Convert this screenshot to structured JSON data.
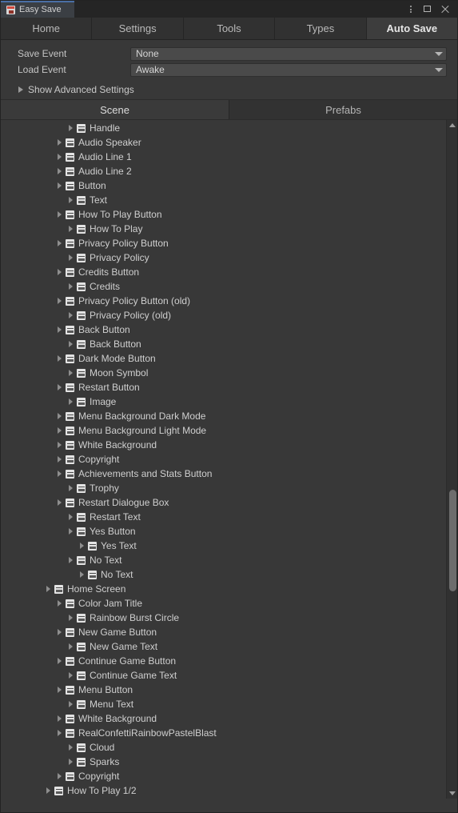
{
  "window": {
    "tab_title": "Easy Save",
    "app_icon": "easy-save-icon",
    "controls": {
      "menu": "kebab-menu-icon",
      "maximize": "maximize-icon",
      "close": "close-icon"
    }
  },
  "tabs": [
    {
      "label": "Home",
      "active": false
    },
    {
      "label": "Settings",
      "active": false
    },
    {
      "label": "Tools",
      "active": false
    },
    {
      "label": "Types",
      "active": false
    },
    {
      "label": "Auto Save",
      "active": true
    }
  ],
  "settings": {
    "fields": [
      {
        "label": "Save Event",
        "value": "None"
      },
      {
        "label": "Load Event",
        "value": "Awake"
      }
    ],
    "advanced_foldout": "Show Advanced Settings"
  },
  "source_tabs": [
    {
      "label": "Scene",
      "active": true
    },
    {
      "label": "Prefabs",
      "active": false
    }
  ],
  "tree": [
    {
      "depth": 2,
      "label": "Handle"
    },
    {
      "depth": 1,
      "label": "Audio Speaker"
    },
    {
      "depth": 1,
      "label": "Audio Line 1"
    },
    {
      "depth": 1,
      "label": "Audio Line 2"
    },
    {
      "depth": 1,
      "label": "Button"
    },
    {
      "depth": 2,
      "label": "Text"
    },
    {
      "depth": 1,
      "label": "How To Play Button"
    },
    {
      "depth": 2,
      "label": "How To Play"
    },
    {
      "depth": 1,
      "label": "Privacy Policy Button"
    },
    {
      "depth": 2,
      "label": "Privacy Policy"
    },
    {
      "depth": 1,
      "label": "Credits Button"
    },
    {
      "depth": 2,
      "label": "Credits"
    },
    {
      "depth": 1,
      "label": "Privacy Policy Button (old)"
    },
    {
      "depth": 2,
      "label": "Privacy Policy (old)"
    },
    {
      "depth": 1,
      "label": "Back Button"
    },
    {
      "depth": 2,
      "label": "Back Button"
    },
    {
      "depth": 1,
      "label": "Dark Mode Button"
    },
    {
      "depth": 2,
      "label": "Moon Symbol"
    },
    {
      "depth": 1,
      "label": "Restart Button"
    },
    {
      "depth": 2,
      "label": "Image"
    },
    {
      "depth": 1,
      "label": "Menu Background Dark Mode"
    },
    {
      "depth": 1,
      "label": "Menu Background Light Mode"
    },
    {
      "depth": 1,
      "label": "White Background"
    },
    {
      "depth": 1,
      "label": "Copyright"
    },
    {
      "depth": 1,
      "label": "Achievements and Stats Button"
    },
    {
      "depth": 2,
      "label": "Trophy"
    },
    {
      "depth": 1,
      "label": "Restart Dialogue Box"
    },
    {
      "depth": 2,
      "label": "Restart Text"
    },
    {
      "depth": 2,
      "label": "Yes Button"
    },
    {
      "depth": 3,
      "label": "Yes Text"
    },
    {
      "depth": 2,
      "label": "No Text"
    },
    {
      "depth": 3,
      "label": "No Text"
    },
    {
      "depth": 0,
      "label": "Home Screen"
    },
    {
      "depth": 1,
      "label": "Color Jam Title"
    },
    {
      "depth": 2,
      "label": "Rainbow Burst Circle"
    },
    {
      "depth": 1,
      "label": "New Game Button"
    },
    {
      "depth": 2,
      "label": "New Game Text"
    },
    {
      "depth": 1,
      "label": "Continue Game Button"
    },
    {
      "depth": 2,
      "label": "Continue Game Text"
    },
    {
      "depth": 1,
      "label": "Menu Button"
    },
    {
      "depth": 2,
      "label": "Menu Text"
    },
    {
      "depth": 1,
      "label": "White Background"
    },
    {
      "depth": 1,
      "label": "RealConfettiRainbowPastelBlast"
    },
    {
      "depth": 2,
      "label": "Cloud"
    },
    {
      "depth": 2,
      "label": "Sparks"
    },
    {
      "depth": 1,
      "label": "Copyright"
    },
    {
      "depth": 0,
      "label": "How To Play 1/2"
    }
  ],
  "scrollbar": {
    "thumb_top_pct": 54.5,
    "thumb_height_pct": 15.0
  },
  "colors": {
    "background": "#383838",
    "titlebar": "#252525",
    "accent": "#4a6fa5",
    "active_tab": "#3d3d3d",
    "field": "#4a4a4a",
    "text": "#cfcfcf"
  }
}
